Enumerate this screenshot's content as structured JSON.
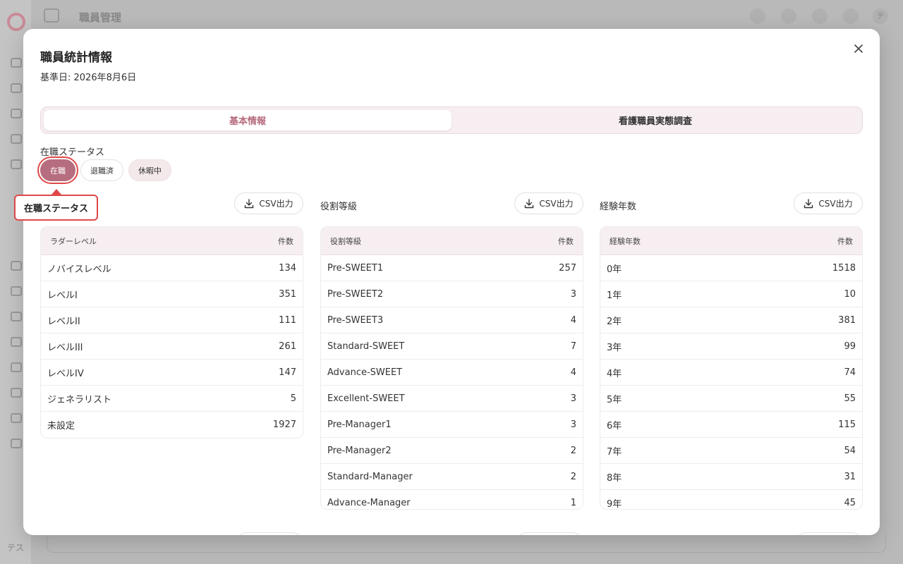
{
  "background": {
    "header_title": "職員管理",
    "avatar_initials": "テス",
    "user_initial": "テ"
  },
  "modal": {
    "title": "職員統計情報",
    "subtitle": "基準日: 2026年8月6日",
    "tabs": [
      {
        "label": "基本情報",
        "active": true
      },
      {
        "label": "看護職員実態調査",
        "active": false
      }
    ],
    "status_filter": {
      "label": "在職ステータス",
      "options": [
        {
          "label": "在職",
          "selected": true
        },
        {
          "label": "退職済",
          "selected": false
        },
        {
          "label": "休暇中",
          "selected": false
        }
      ]
    },
    "tooltip": "在職ステータス",
    "csv_label": "CSV出力",
    "sections": [
      {
        "title": "",
        "columns": [
          "ラダーレベル",
          "件数"
        ],
        "rows": [
          [
            "ノバイスレベル",
            "134"
          ],
          [
            "レベルI",
            "351"
          ],
          [
            "レベルII",
            "111"
          ],
          [
            "レベルIII",
            "261"
          ],
          [
            "レベルIV",
            "147"
          ],
          [
            "ジェネラリスト",
            "5"
          ],
          [
            "未設定",
            "1927"
          ]
        ]
      },
      {
        "title": "役割等級",
        "columns": [
          "役割等級",
          "件数"
        ],
        "rows": [
          [
            "Pre-SWEET1",
            "257"
          ],
          [
            "Pre-SWEET2",
            "3"
          ],
          [
            "Pre-SWEET3",
            "4"
          ],
          [
            "Standard-SWEET",
            "7"
          ],
          [
            "Advance-SWEET",
            "4"
          ],
          [
            "Excellent-SWEET",
            "3"
          ],
          [
            "Pre-Manager1",
            "3"
          ],
          [
            "Pre-Manager2",
            "2"
          ],
          [
            "Standard-Manager",
            "2"
          ],
          [
            "Advance-Manager",
            "1"
          ]
        ]
      },
      {
        "title": "経験年数",
        "columns": [
          "経験年数",
          "件数"
        ],
        "rows": [
          [
            "0年",
            "1518"
          ],
          [
            "1年",
            "10"
          ],
          [
            "2年",
            "381"
          ],
          [
            "3年",
            "99"
          ],
          [
            "4年",
            "74"
          ],
          [
            "5年",
            "55"
          ],
          [
            "6年",
            "115"
          ],
          [
            "7年",
            "54"
          ],
          [
            "8年",
            "31"
          ],
          [
            "9年",
            "45"
          ]
        ]
      }
    ]
  },
  "colors": {
    "accent": "#b66d7e",
    "highlight": "#e04848",
    "tab_bg": "#f6eef0"
  }
}
